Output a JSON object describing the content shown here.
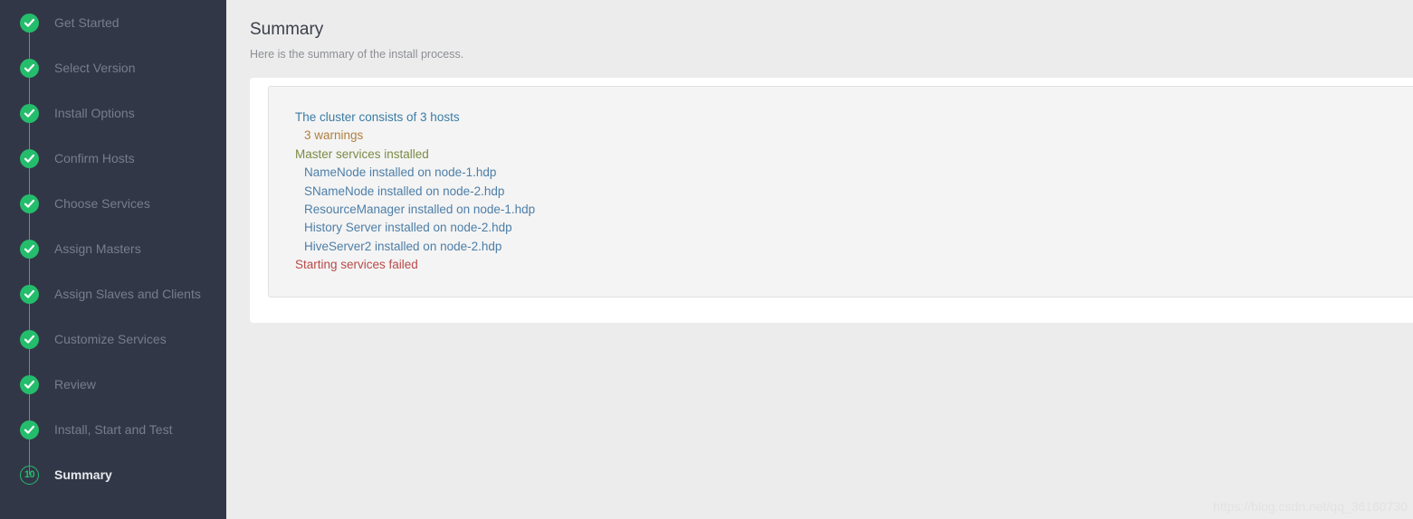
{
  "sidebar": {
    "items": [
      {
        "label": "Get Started",
        "state": "done",
        "icon": "check-icon"
      },
      {
        "label": "Select Version",
        "state": "done",
        "icon": "check-icon"
      },
      {
        "label": "Install Options",
        "state": "done",
        "icon": "check-icon"
      },
      {
        "label": "Confirm Hosts",
        "state": "done",
        "icon": "check-icon"
      },
      {
        "label": "Choose Services",
        "state": "done",
        "icon": "check-icon"
      },
      {
        "label": "Assign Masters",
        "state": "done",
        "icon": "check-icon"
      },
      {
        "label": "Assign Slaves and Clients",
        "state": "done",
        "icon": "check-icon"
      },
      {
        "label": "Customize Services",
        "state": "done",
        "icon": "check-icon"
      },
      {
        "label": "Review",
        "state": "done",
        "icon": "check-icon"
      },
      {
        "label": "Install, Start and Test",
        "state": "done",
        "icon": "check-icon"
      },
      {
        "label": "Summary",
        "state": "current",
        "step_number": "10"
      }
    ]
  },
  "main": {
    "title": "Summary",
    "subtitle": "Here is the summary of the install process.",
    "summary_items": [
      {
        "text": "The cluster consists of 3 hosts",
        "level": 0,
        "tone": "info"
      },
      {
        "text": "3 warnings",
        "level": 1,
        "tone": "warning"
      },
      {
        "text": "Master services installed",
        "level": 0,
        "tone": "ok"
      },
      {
        "text": "NameNode installed on node-1.hdp",
        "level": 1,
        "tone": "link"
      },
      {
        "text": "SNameNode installed on node-2.hdp",
        "level": 1,
        "tone": "link"
      },
      {
        "text": "ResourceManager installed on node-1.hdp",
        "level": 1,
        "tone": "link"
      },
      {
        "text": "History Server installed on node-2.hdp",
        "level": 1,
        "tone": "link"
      },
      {
        "text": "HiveServer2 installed on node-2.hdp",
        "level": 1,
        "tone": "link"
      },
      {
        "text": "Starting services failed",
        "level": 0,
        "tone": "error"
      }
    ]
  },
  "watermark": {
    "text": "https://blog.csdn.net/qq_36160730"
  },
  "colors": {
    "sidebar_bg": "#323747",
    "accent_green": "#24bd6c",
    "page_bg": "#ececec",
    "card_bg": "#ffffff",
    "panel_bg": "#f4f4f4",
    "warning": "#b07f3e",
    "ok": "#7a8b46",
    "error": "#b94a48",
    "info": "#3a7ca5"
  }
}
